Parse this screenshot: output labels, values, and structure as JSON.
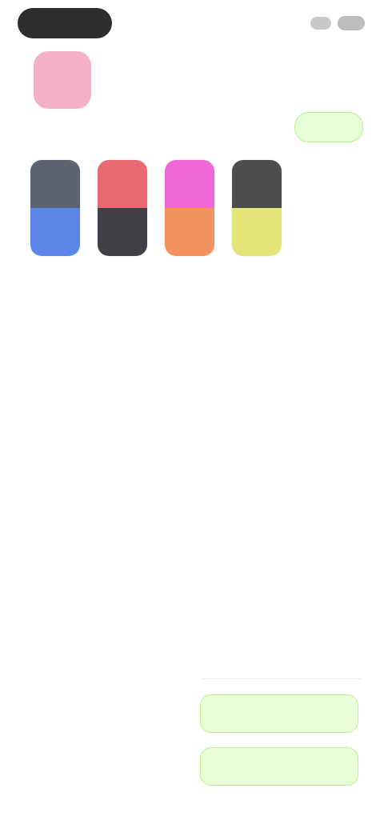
{
  "profile": {
    "avatar_initial": "",
    "name": ""
  },
  "header": {
    "action_label": ""
  },
  "swatches": [
    {
      "top": "#5c6471",
      "bottom": "#5a86e8"
    },
    {
      "top": "#e76a73",
      "bottom": "#3f4146"
    },
    {
      "top": "#ee67d5",
      "bottom": "#f2935f"
    },
    {
      "top": "#4d4d4d",
      "bottom": "#e3e57b"
    }
  ],
  "list": {
    "items": [
      {
        "label": "",
        "sub": ""
      },
      {
        "label": "",
        "sub": ""
      },
      {
        "label": "",
        "sub": ""
      },
      {
        "label": "",
        "sub": ""
      },
      {
        "label": "",
        "sub": "",
        "danger": true
      },
      {
        "label": "",
        "sub": ""
      }
    ]
  },
  "bottom": {
    "primary_label": "",
    "secondary_label": ""
  }
}
